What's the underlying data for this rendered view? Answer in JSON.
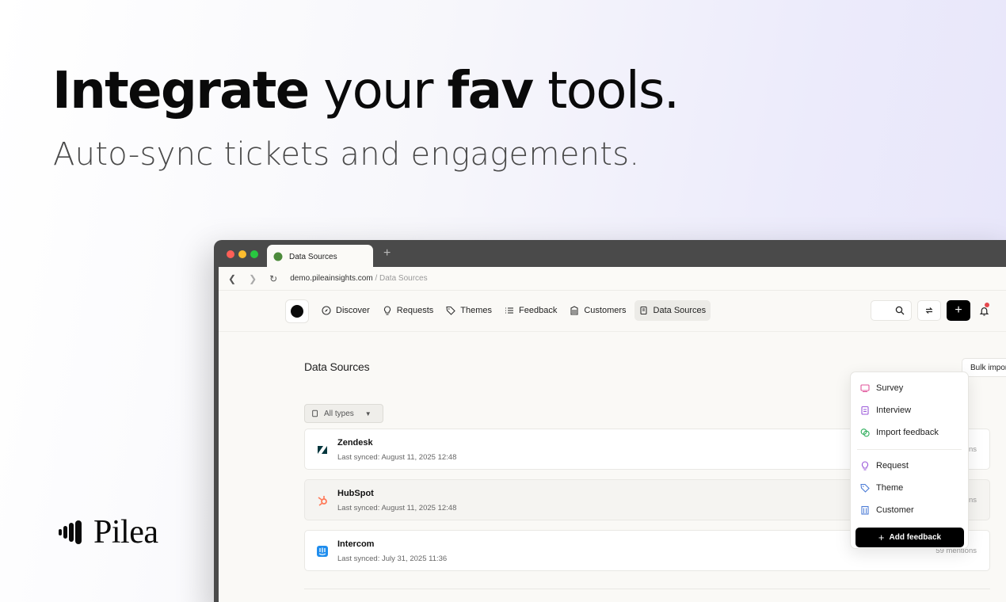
{
  "hero": {
    "title_part1": "Integrate",
    "title_part2": " your ",
    "title_part3": "fav",
    "title_part4": " tools.",
    "subtitle": "Auto-sync tickets and engagements."
  },
  "brand": {
    "name": "Pilea"
  },
  "browser": {
    "tab_title": "Data Sources",
    "new_tab_symbol": "+",
    "url_host": "demo.pileainsights.com",
    "url_path": " / Data Sources"
  },
  "nav": {
    "items": [
      {
        "label": "Discover",
        "icon": "compass-icon"
      },
      {
        "label": "Requests",
        "icon": "lightbulb-icon"
      },
      {
        "label": "Themes",
        "icon": "tag-icon"
      },
      {
        "label": "Feedback",
        "icon": "list-icon"
      },
      {
        "label": "Customers",
        "icon": "building-icon"
      },
      {
        "label": "Data Sources",
        "icon": "database-icon",
        "active": true
      }
    ],
    "plus_symbol": "+"
  },
  "page": {
    "title": "Data Sources",
    "bulk_import_label": "Bulk impor",
    "filter_label": "All types"
  },
  "sources": [
    {
      "name": "Zendesk",
      "last_synced": "Last synced: August 11, 2025 12:48",
      "mentions": "ntions",
      "icon": "zendesk-icon"
    },
    {
      "name": "HubSpot",
      "last_synced": "Last synced: August 11, 2025 12:48",
      "mentions": "o mentions",
      "icon": "hubspot-icon"
    },
    {
      "name": "Intercom",
      "last_synced": "Last synced: July 31, 2025 11:36",
      "mentions": "59 mentions",
      "icon": "intercom-icon"
    }
  ],
  "dropdown": {
    "items_top": [
      {
        "label": "Survey",
        "icon": "survey-icon",
        "color": "#e0559b"
      },
      {
        "label": "Interview",
        "icon": "clipboard-icon",
        "color": "#9b59d9"
      },
      {
        "label": "Import feedback",
        "icon": "chat-icon",
        "color": "#2fae5c"
      }
    ],
    "items_bottom": [
      {
        "label": "Request",
        "icon": "lightbulb-icon",
        "color": "#9b59d9"
      },
      {
        "label": "Theme",
        "icon": "tag-icon",
        "color": "#4a7bd6"
      },
      {
        "label": "Customer",
        "icon": "building-icon",
        "color": "#4a7bd6"
      }
    ],
    "add_label": "Add feedback"
  },
  "colors": {
    "accent": "#000000",
    "tab_favicon": "#4c8a3b",
    "notification": "#e5484d",
    "hubspot": "#ff7a59",
    "intercom": "#1f8ded"
  }
}
